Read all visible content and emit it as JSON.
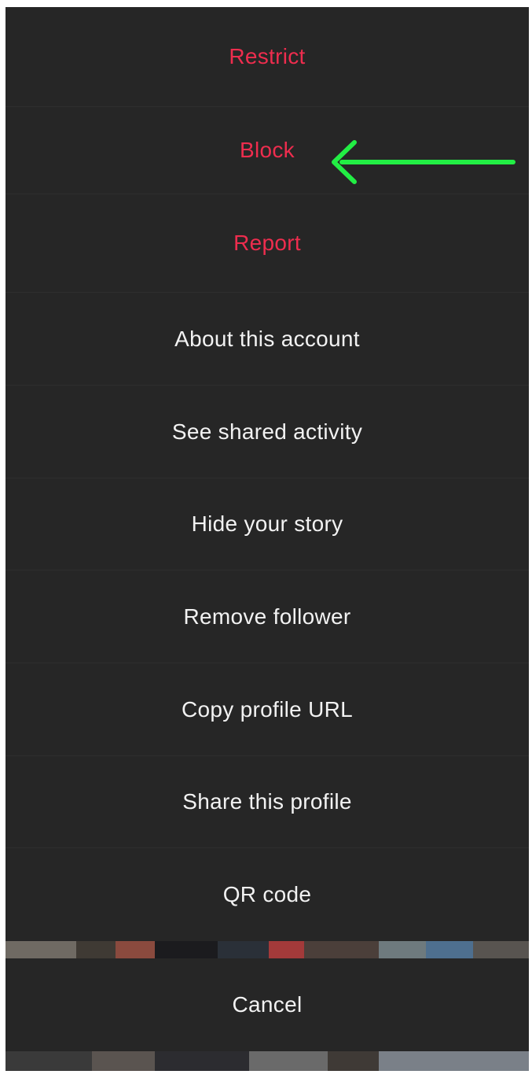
{
  "menu": {
    "items": [
      {
        "label": "Restrict",
        "style": "danger"
      },
      {
        "label": "Block",
        "style": "danger"
      },
      {
        "label": "Report",
        "style": "danger"
      },
      {
        "label": "About this account",
        "style": "normal"
      },
      {
        "label": "See shared activity",
        "style": "normal"
      },
      {
        "label": "Hide your story",
        "style": "normal"
      },
      {
        "label": "Remove follower",
        "style": "normal"
      },
      {
        "label": "Copy profile URL",
        "style": "normal"
      },
      {
        "label": "Share this profile",
        "style": "normal"
      },
      {
        "label": "QR code",
        "style": "normal"
      }
    ],
    "cancel_label": "Cancel"
  },
  "annotation": {
    "icon": "left-arrow-icon",
    "color": "#22ee44",
    "points_to": "Block"
  },
  "colors": {
    "sheet_background": "#262626",
    "danger_text": "#ee2d4e",
    "normal_text": "#f2f2f2",
    "backdrop": "#000000"
  }
}
